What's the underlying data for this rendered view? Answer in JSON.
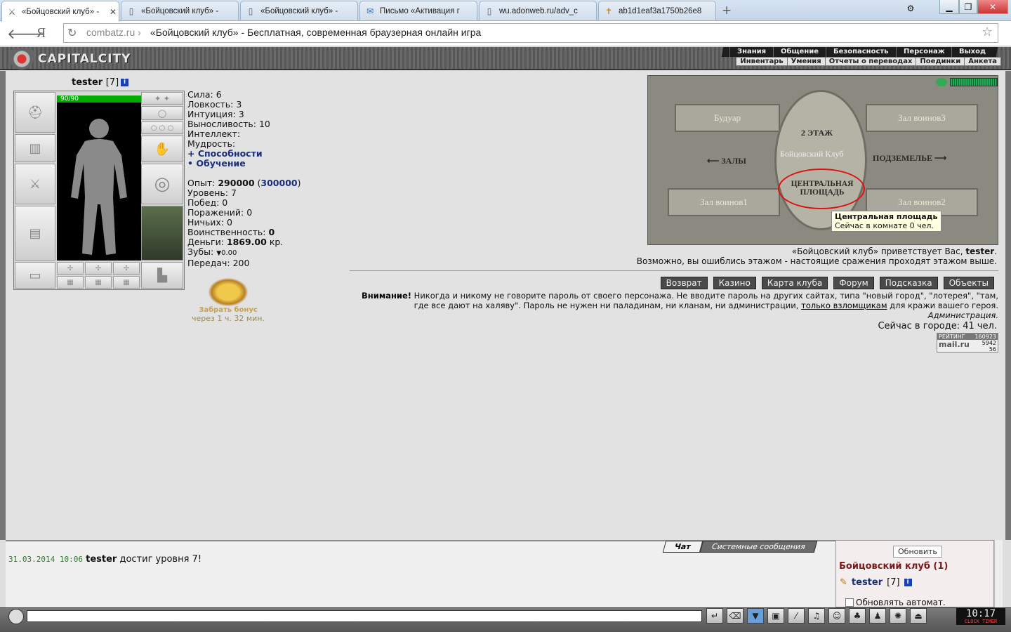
{
  "browser": {
    "tabs": [
      {
        "label": "«Бойцовский клуб» -",
        "icon": "crossed-swords-icon"
      },
      {
        "label": "«Бойцовский клуб» -",
        "icon": "page-icon"
      },
      {
        "label": "«Бойцовский клуб» -",
        "icon": "page-icon"
      },
      {
        "label": "Письмо «Активация г",
        "icon": "mail-icon"
      },
      {
        "label": "wu.adonweb.ru/adv_c",
        "icon": "page-icon"
      },
      {
        "label": "ab1d1eaf3a1750b26e8",
        "icon": "cross-icon"
      }
    ],
    "url_host": "combatz.ru",
    "url_sep": "›",
    "url_title": "«Бойцовский клуб» - Бесплатная, современная браузерная онлайн игра",
    "yandex_glyph": "Я"
  },
  "game": {
    "logo_text": "CAPITALCITY",
    "menu": [
      "Знания",
      "Общение",
      "Безопасность",
      "Персонаж",
      "Выход"
    ],
    "submenu": [
      "Инвентарь",
      "Умения",
      "Отчеты о переводах",
      "Поединки",
      "Анкета"
    ]
  },
  "character": {
    "name": "tester",
    "level": "[7]",
    "hp": "90/90",
    "stats": [
      {
        "label": "Сила:",
        "value": "6"
      },
      {
        "label": "Ловкость:",
        "value": "3"
      },
      {
        "label": "Интуиция:",
        "value": "3"
      },
      {
        "label": "Выносливость:",
        "value": "10"
      },
      {
        "label": "Интеллект:",
        "value": ""
      },
      {
        "label": "Мудрость:",
        "value": ""
      }
    ],
    "abilities_link": "+ Способности",
    "training_link": "• Обучение",
    "exp_label": "Опыт:",
    "exp": "290000",
    "exp_next": "300000",
    "info": [
      {
        "label": "Уровень:",
        "value": "7"
      },
      {
        "label": "Побед:",
        "value": "0"
      },
      {
        "label": "Поражений:",
        "value": "0"
      },
      {
        "label": "Ничьих:",
        "value": "0"
      }
    ],
    "belligerence_label": "Воинственность:",
    "belligerence": "0",
    "money_label": "Деньги:",
    "money": "1869.00",
    "money_unit": "кр.",
    "teeth_label": "Зубы:",
    "teeth": "0.00",
    "transfers_label": "Передач:",
    "transfers": "200",
    "bonus_label": "Забрать бонус",
    "bonus_timer": "через 1 ч. 32 мин."
  },
  "map": {
    "rooms": [
      "Будуар",
      "Зал воинов3",
      "Зал воинов1",
      "Зал воинов2"
    ],
    "floor": "2 ЭТАЖ",
    "club": "Бойцовский Клуб",
    "halls": "ЗАЛЫ",
    "dungeon": "ПОДЗЕМЕЛЬЕ",
    "center": "ЦЕНТРАЛЬНАЯ ПЛОЩАДЬ",
    "tooltip_title": "Центральная площадь",
    "tooltip_sub": "Сейчас в комнате 0 чел."
  },
  "welcome": {
    "line1_pre": "«Бойцовский клуб» приветствует Вас, ",
    "line1_name": "tester",
    "line1_post": ".",
    "line2": "Возможно, вы ошиблись этажом - настоящие сражения проходят этажом выше."
  },
  "buttons": [
    "Возврат",
    "Казино",
    "Карта клуба",
    "Форум",
    "Подсказка",
    "Объекты"
  ],
  "warning": {
    "bold": "Внимание!",
    "text": " Никогда и никому не говорите пароль от своего персонажа. Не вводите пароль на других сайтах, типа \"новый город\", \"лотерея\", \"там, где все дают на халяву\". Пароль не нужен ни паладинам, ни кланам, ни администрации,",
    "link": "только взломщикам",
    "tail": " для кражи вашего героя.",
    "sign": "Администрация."
  },
  "online": "Сейчас в городе: 41 чел.",
  "counter": {
    "label": "РЕЙТИНГ",
    "v1": "160923",
    "v2": "5942",
    "v3": "56",
    "brand": "mail.ru"
  },
  "chat": {
    "tabs": [
      "Чат",
      "Системные сообщения"
    ],
    "time": "31.03.2014 10:06",
    "user": "tester",
    "message": " достиг уровня 7!"
  },
  "online_panel": {
    "refresh": "Обновить",
    "club": "Бойцовский клуб (1)",
    "user": "tester",
    "user_level": "[7]",
    "auto": "Обновлять автомат."
  },
  "clock": {
    "time": "10:17",
    "label": "CLOCK  TIMER"
  }
}
